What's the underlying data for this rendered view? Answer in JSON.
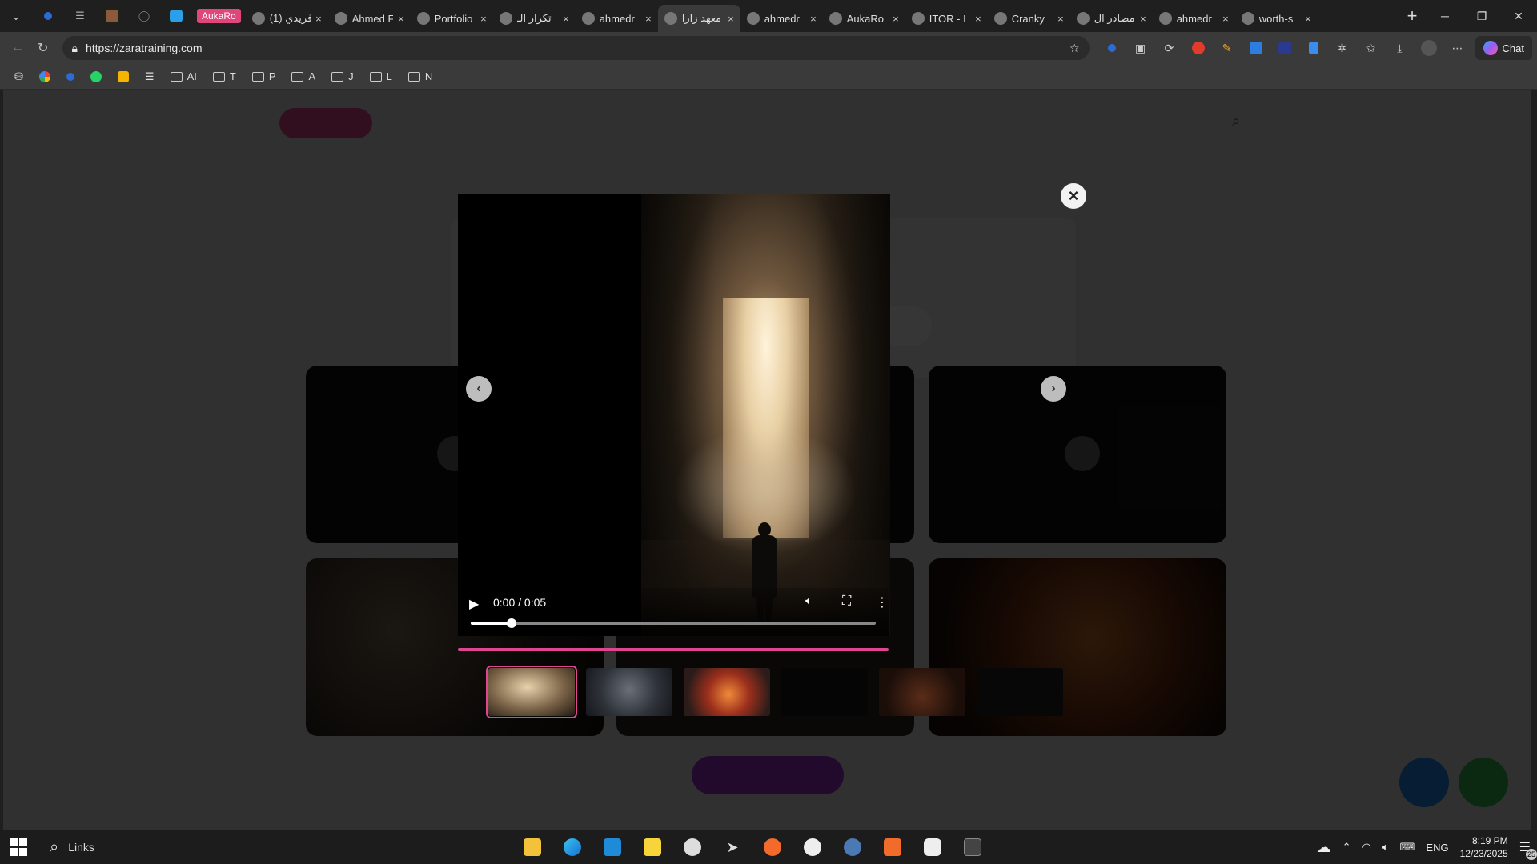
{
  "browser": {
    "pinned_labels": {
      "aukaro": "AukaRo"
    },
    "tabs": [
      {
        "title": "(1) فريدي",
        "active": false
      },
      {
        "title": "Ahmed F",
        "active": false
      },
      {
        "title": "Portfolio",
        "active": false
      },
      {
        "title": "تكرار الـ",
        "active": false
      },
      {
        "title": "ahmedr",
        "active": false
      },
      {
        "title": "معهد زارا",
        "active": true
      },
      {
        "title": "ahmedr",
        "active": false
      },
      {
        "title": "AukaRo",
        "active": false
      },
      {
        "title": "ITOR - I",
        "active": false
      },
      {
        "title": "Cranky",
        "active": false
      },
      {
        "title": "مصادر ال",
        "active": false
      },
      {
        "title": "ahmedr",
        "active": false
      },
      {
        "title": "worth-s",
        "active": false
      }
    ],
    "close_glyph": "×",
    "newtab_glyph": "+",
    "url": "https://zaratraining.com",
    "chat_label": "Chat",
    "bookmark_folders": [
      "AI",
      "T",
      "P",
      "A",
      "J",
      "L",
      "N"
    ]
  },
  "modal": {
    "close_glyph": "×",
    "video_time": "0:00 / 0:05",
    "progress": 0.1,
    "arrow_left": "‹",
    "arrow_right": "›",
    "thumbnails_count": 6,
    "active_thumbnail": 0
  },
  "taskbar": {
    "search_label": "Links",
    "lang": "ENG",
    "time": "8:19 PM",
    "date": "12/23/2025",
    "notification_count": "25"
  },
  "colors": {
    "accent_pink": "#e0458f",
    "purple_button": "#9b2fc8",
    "fab_blue": "#1e86e8",
    "fab_green": "#35b84b"
  }
}
